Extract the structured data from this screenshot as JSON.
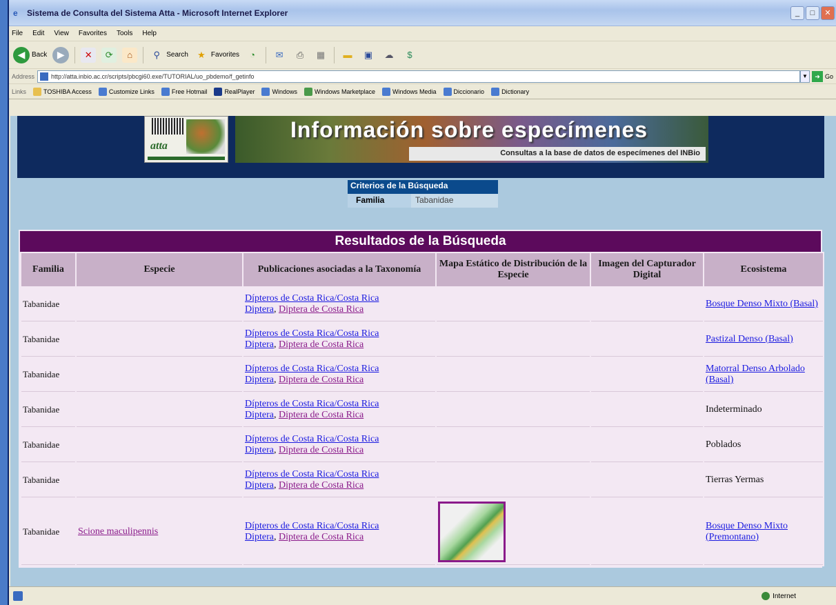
{
  "window": {
    "title": "Sistema de Consulta del Sistema Atta - Microsoft Internet Explorer",
    "min": "_",
    "max": "□",
    "close": "✕"
  },
  "menu": [
    "File",
    "Edit",
    "View",
    "Favorites",
    "Tools",
    "Help"
  ],
  "toolbar": {
    "back": "Back",
    "search": "Search",
    "favorites": "Favorites"
  },
  "address": {
    "label": "Address",
    "url": "http://atta.inbio.ac.cr/scripts/pbcgi60.exe/TUTORIAL/uo_pbdemo/f_getinfo",
    "go": "Go"
  },
  "links": {
    "label": "Links",
    "items": [
      "TOSHIBA Access",
      "Customize Links",
      "Free Hotmail",
      "RealPlayer",
      "Windows",
      "Windows Marketplace",
      "Windows Media",
      "Diccionario",
      "Dictionary"
    ]
  },
  "banner": {
    "logo_text": "atta",
    "title": "Información sobre especímenes",
    "subtitle": "Consultas a la base de datos de especímenes del INBio"
  },
  "criteria": {
    "title": "Criterios de la Búsqueda",
    "key": "Familia",
    "value": "Tabanidae"
  },
  "results": {
    "title": "Resultados de la Búsqueda",
    "headers": [
      "Familia",
      "Especie",
      "Publicaciones asociadas a la Taxonomía",
      "Mapa Estático de Distribución de la Especie",
      "Imagen del Capturador Digital",
      "Ecosistema"
    ],
    "pub_link1": "Dípteros de Costa Rica/Costa Rica",
    "pub_link2": "Diptera",
    "pub_link3": "Diptera de Costa Rica",
    "rows": [
      {
        "familia": "Tabanidae",
        "especie": "",
        "ecosistema": "Bosque Denso Mixto (Basal)",
        "eco_link": true,
        "map": false
      },
      {
        "familia": "Tabanidae",
        "especie": "",
        "ecosistema": "Pastizal Denso (Basal)",
        "eco_link": true,
        "map": false
      },
      {
        "familia": "Tabanidae",
        "especie": "",
        "ecosistema": "Matorral Denso Arbolado (Basal)",
        "eco_link": true,
        "map": false
      },
      {
        "familia": "Tabanidae",
        "especie": "",
        "ecosistema": "Indeterminado",
        "eco_link": false,
        "map": false
      },
      {
        "familia": "Tabanidae",
        "especie": "",
        "ecosistema": "Poblados",
        "eco_link": false,
        "map": false
      },
      {
        "familia": "Tabanidae",
        "especie": "",
        "ecosistema": "Tierras Yermas",
        "eco_link": false,
        "map": false
      },
      {
        "familia": "Tabanidae",
        "especie": "Scione maculipennis",
        "ecosistema": "Bosque Denso Mixto (Premontano)",
        "eco_link": true,
        "map": true
      }
    ]
  },
  "status": {
    "zone": "Internet"
  }
}
